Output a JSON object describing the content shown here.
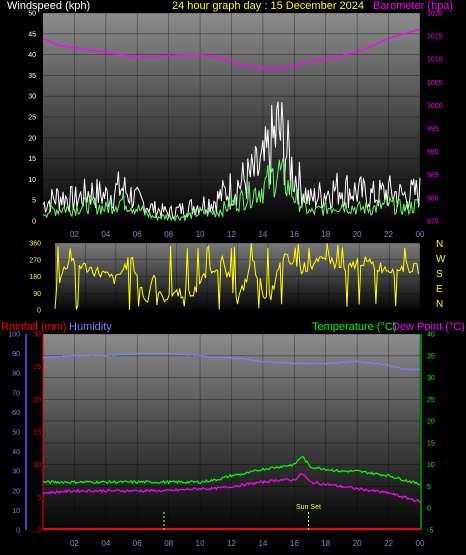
{
  "chart_data": [
    {
      "type": "line",
      "title": "24 hour graph day : 15 December 2024",
      "left_label": "Windspeed (kph)",
      "right_label": "Barometer (hpa)",
      "x_ticks": [
        "02",
        "04",
        "06",
        "08",
        "10",
        "12",
        "14",
        "16",
        "18",
        "20",
        "22",
        "00"
      ],
      "y_left": {
        "min": 0,
        "max": 50,
        "ticks": [
          0,
          5,
          10,
          15,
          20,
          25,
          30,
          35,
          40,
          45,
          50
        ]
      },
      "y_right": {
        "min": 975,
        "max": 1020,
        "ticks": [
          975,
          980,
          985,
          990,
          995,
          1000,
          1005,
          1010,
          1015,
          1020
        ]
      },
      "grid": true,
      "series": [
        {
          "name": "Barometer (hpa)",
          "color": "#ff00ff",
          "axis": "right",
          "x": [
            0,
            1,
            2,
            3,
            4,
            5,
            6,
            7,
            8,
            9,
            10,
            11,
            12,
            13,
            14,
            15,
            16,
            17,
            18,
            19,
            20,
            21,
            22,
            23,
            24
          ],
          "values": [
            1014.5,
            1013,
            1012.5,
            1012,
            1011.5,
            1011,
            1010.5,
            1010.5,
            1010.8,
            1011,
            1011,
            1010.5,
            1009.5,
            1008.5,
            1008,
            1008,
            1008.5,
            1009.5,
            1010,
            1010.8,
            1011.5,
            1013,
            1014.5,
            1015.5,
            1016.5
          ]
        },
        {
          "name": "Wind gust",
          "color": "#ffffff",
          "axis": "left",
          "x": [
            0,
            1,
            2,
            3,
            4,
            5,
            6,
            7,
            8,
            9,
            10,
            11,
            12,
            13,
            14,
            15,
            16,
            17,
            18,
            19,
            20,
            21,
            22,
            23,
            24
          ],
          "values": [
            4,
            6,
            5,
            7,
            6,
            8,
            5,
            3,
            2,
            3,
            4,
            5,
            8,
            10,
            13,
            22,
            11,
            5,
            7,
            8,
            7,
            6,
            7,
            6,
            7
          ]
        },
        {
          "name": "Wind speed",
          "color": "#6fef6f",
          "axis": "left",
          "x": [
            0,
            1,
            2,
            3,
            4,
            5,
            6,
            7,
            8,
            9,
            10,
            11,
            12,
            13,
            14,
            15,
            16,
            17,
            18,
            19,
            20,
            21,
            22,
            23,
            24
          ],
          "values": [
            2,
            3,
            3,
            4,
            3,
            5,
            3,
            1,
            1,
            1,
            2,
            2,
            4,
            6,
            8,
            12,
            6,
            2,
            3,
            4,
            3,
            3,
            4,
            3,
            4
          ]
        }
      ]
    },
    {
      "type": "line",
      "title": "",
      "x_ticks": [
        "02",
        "04",
        "06",
        "08",
        "10",
        "12",
        "14",
        "16",
        "18",
        "20",
        "22",
        "00"
      ],
      "y_left": {
        "min": 0,
        "max": 360,
        "ticks": [
          0,
          90,
          180,
          270,
          360
        ]
      },
      "right_labels": [
        "N",
        "W",
        "S",
        "E",
        "N"
      ],
      "grid": true,
      "series": [
        {
          "name": "Wind direction",
          "color": "#ffff00",
          "x": [
            0,
            1,
            1.5,
            2,
            3,
            4,
            5,
            6,
            6.5,
            7,
            8,
            9,
            10,
            11,
            12,
            13,
            14,
            15,
            16,
            17,
            18,
            19,
            20,
            21,
            22,
            23,
            24
          ],
          "values": [
            120,
            280,
            250,
            230,
            200,
            160,
            280,
            40,
            200,
            60,
            100,
            80,
            200,
            260,
            40,
            260,
            30,
            290,
            220,
            240,
            280,
            200,
            270,
            240,
            220,
            230,
            220
          ]
        }
      ]
    },
    {
      "type": "line",
      "title": "",
      "left_labels": [
        "Rainfall (mm)",
        "Humidity"
      ],
      "right_labels": [
        "Temperature (°C)",
        "Dew Point (°C)"
      ],
      "x_ticks": [
        "02",
        "04",
        "06",
        "08",
        "10",
        "12",
        "14",
        "16",
        "18",
        "20",
        "22",
        "00"
      ],
      "y_humidity": {
        "min": 0,
        "max": 100,
        "ticks": [
          0,
          10,
          20,
          30,
          40,
          50,
          60,
          70,
          80,
          90,
          100
        ]
      },
      "y_rain": {
        "min": 0,
        "max": 30,
        "ticks": [
          0,
          5,
          10,
          15,
          20,
          25,
          30
        ]
      },
      "y_temp": {
        "min": -5,
        "max": 40,
        "ticks": [
          -5,
          0,
          5,
          10,
          15,
          20,
          25,
          30,
          35,
          40
        ]
      },
      "annotation": "Sun Set",
      "grid": true,
      "series": [
        {
          "name": "Humidity",
          "color": "#7d7dff",
          "axis": "humidity",
          "x": [
            0,
            2,
            4,
            6,
            8,
            10,
            11,
            12,
            14,
            16,
            18,
            20,
            21,
            22,
            23,
            24
          ],
          "values": [
            88,
            89,
            89,
            90,
            90,
            89,
            88,
            88,
            86,
            85,
            85,
            86,
            85,
            84,
            82,
            82
          ]
        },
        {
          "name": "Temperature (°C)",
          "color": "#00ff00",
          "axis": "temp",
          "x": [
            0,
            1,
            2,
            4,
            6,
            8,
            10,
            11,
            12,
            13,
            14,
            15,
            16,
            16.5,
            17,
            18,
            19,
            20,
            21,
            22,
            23,
            24
          ],
          "values": [
            6,
            6,
            6,
            6,
            6,
            6,
            6,
            6.5,
            7.5,
            8,
            9,
            9.5,
            10,
            12,
            9.5,
            9,
            8.5,
            8.5,
            8,
            7.5,
            6.5,
            5.5
          ]
        },
        {
          "name": "Dew Point (°C)",
          "color": "#ff00ff",
          "axis": "temp",
          "x": [
            0,
            2,
            4,
            6,
            8,
            10,
            11,
            12,
            13,
            14,
            15,
            16,
            16.5,
            17,
            18,
            19,
            20,
            21,
            22,
            23,
            24
          ],
          "values": [
            3.5,
            4,
            4,
            4,
            4,
            4.5,
            4.5,
            5,
            5.5,
            6,
            6.5,
            6.5,
            8,
            6,
            5.5,
            5,
            4.5,
            4,
            3.5,
            2.5,
            1.5
          ]
        },
        {
          "name": "Rainfall (mm)",
          "color": "#ff0000",
          "axis": "rain",
          "x": [
            0,
            24
          ],
          "values": [
            0,
            0
          ]
        }
      ]
    }
  ],
  "colors": {
    "wind_label": "#ffffff",
    "title": "#ffff00",
    "barometer": "#ff00ff",
    "rainfall": "#ff0000",
    "humidity": "#7d7dff",
    "temperature": "#00ff00",
    "dew_point": "#ff00ff"
  }
}
